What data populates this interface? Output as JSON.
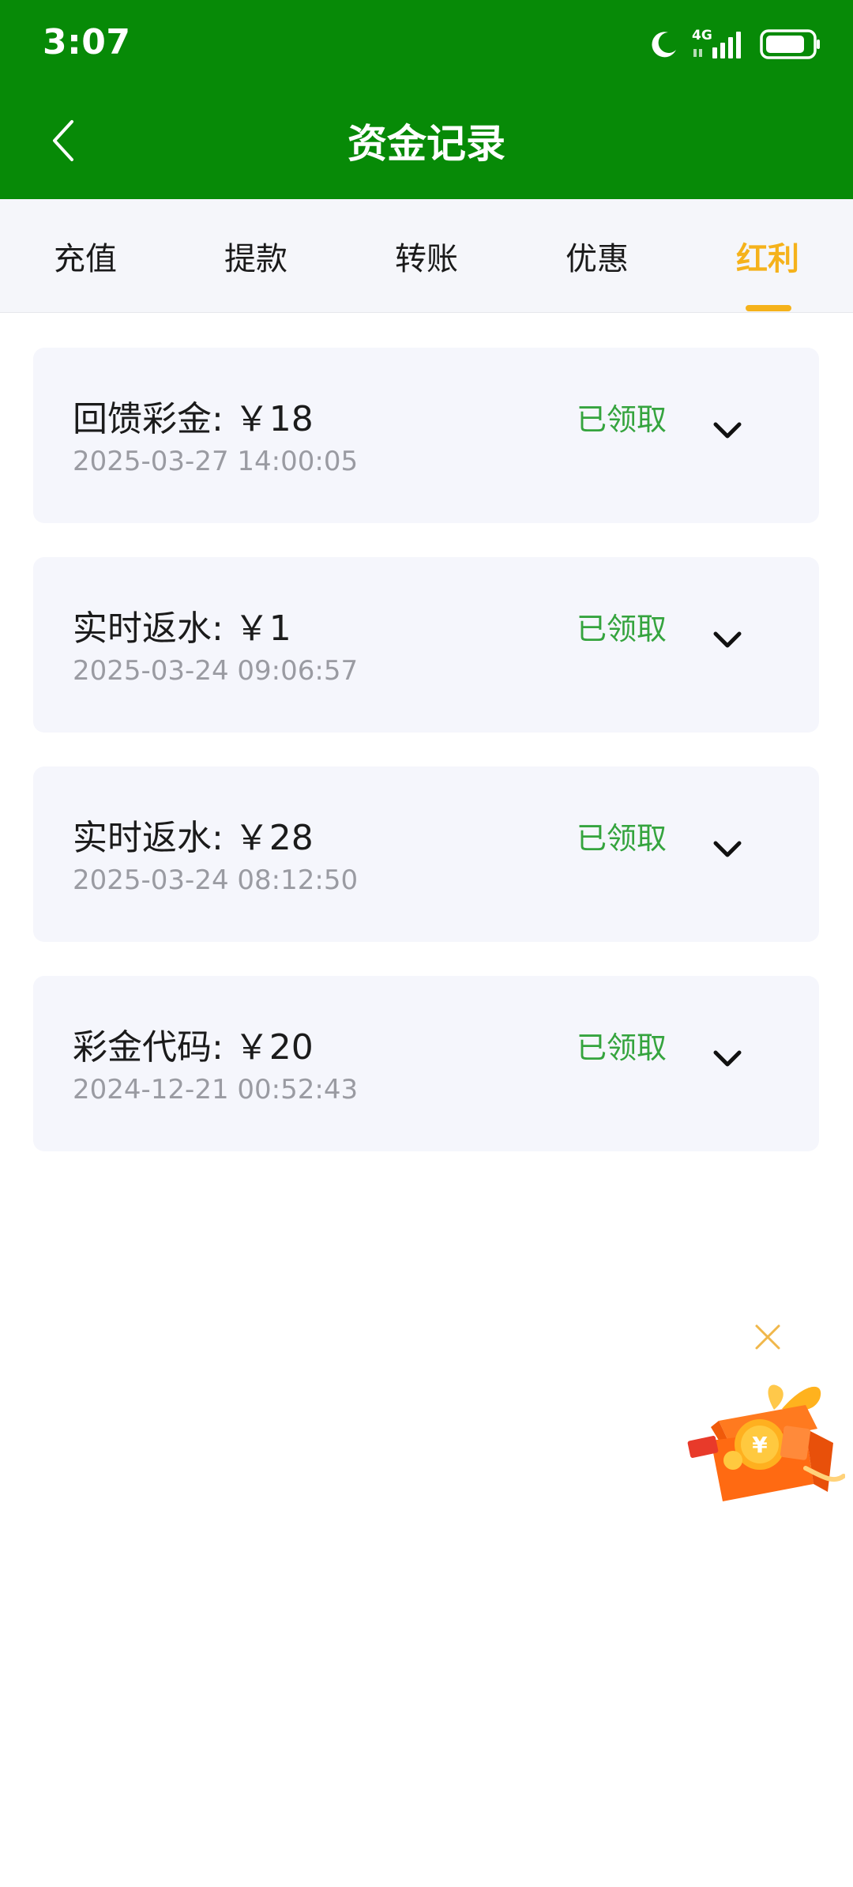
{
  "status_bar": {
    "time": "3:07",
    "network": "4G"
  },
  "header": {
    "title": "资金记录",
    "back_icon": "chevron-left-icon"
  },
  "tabs": [
    {
      "label": "充值",
      "active": false
    },
    {
      "label": "提款",
      "active": false
    },
    {
      "label": "转账",
      "active": false
    },
    {
      "label": "优惠",
      "active": false
    },
    {
      "label": "红利",
      "active": true
    }
  ],
  "records": [
    {
      "title": "回馈彩金: ￥18",
      "time": "2025-03-27 14:00:05",
      "status": "已领取"
    },
    {
      "title": "实时返水: ￥1",
      "time": "2025-03-24 09:06:57",
      "status": "已领取"
    },
    {
      "title": "实时返水: ￥28",
      "time": "2025-03-24 08:12:50",
      "status": "已领取"
    },
    {
      "title": "彩金代码: ￥20",
      "time": "2024-12-21 00:52:43",
      "status": "已领取"
    }
  ],
  "colors": {
    "header_bg": "#078a07",
    "active_tab": "#f5b21b",
    "status_green": "#35a43e",
    "card_bg": "#f5f6fc"
  },
  "floating_promo": {
    "icon": "gift-box-icon",
    "close_icon": "close-icon"
  }
}
